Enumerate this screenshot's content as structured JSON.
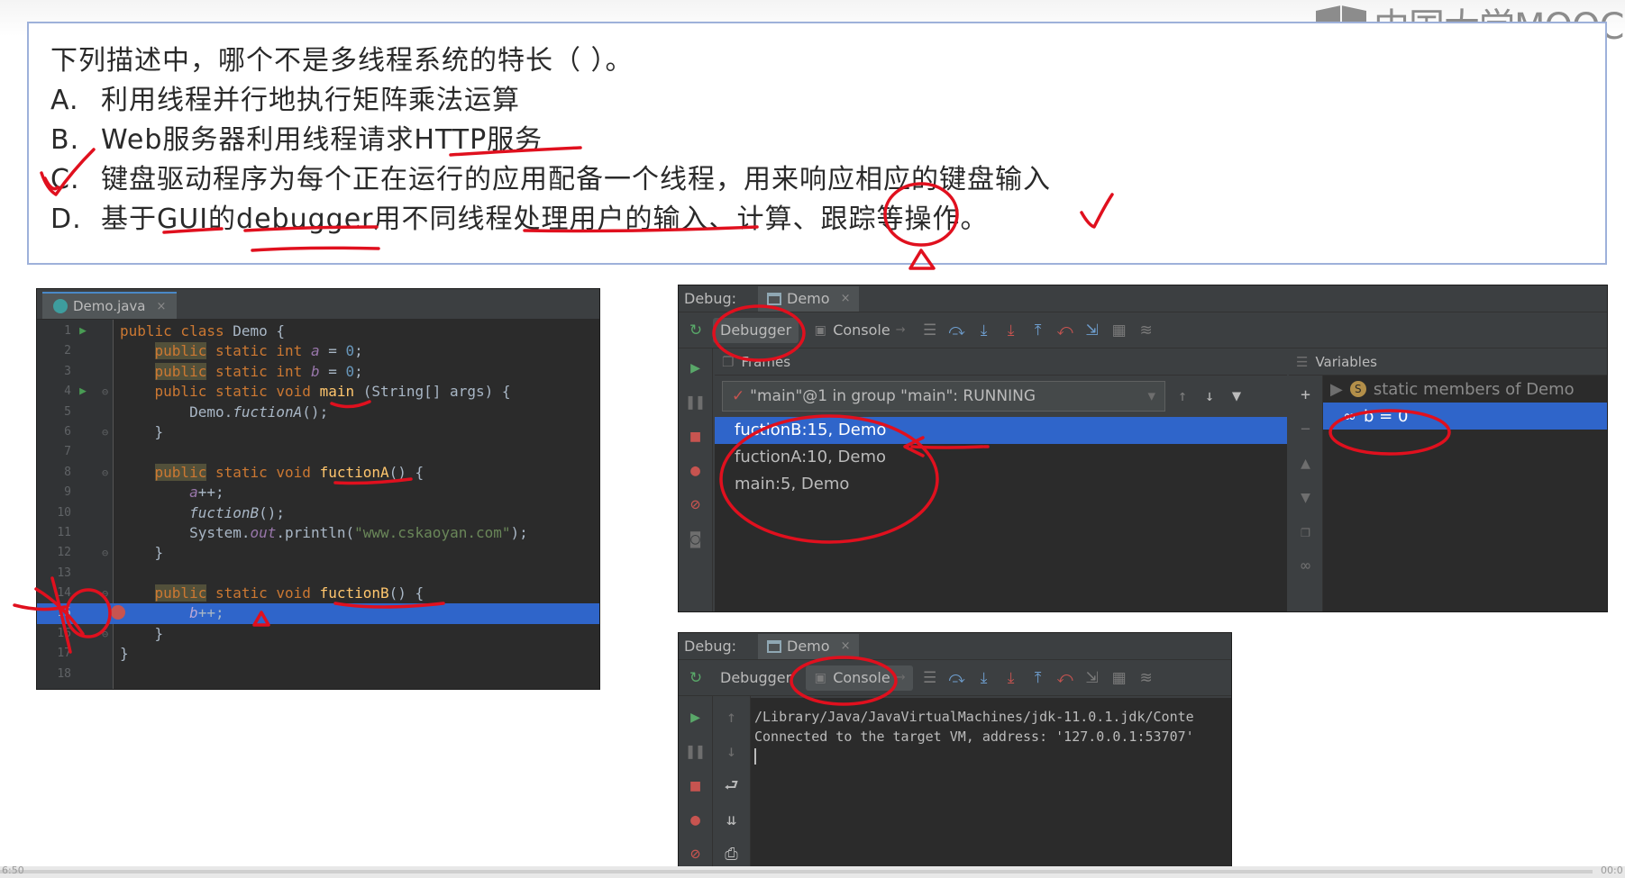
{
  "logo": {
    "text": "中国大学MOOC"
  },
  "question": {
    "stem": "下列描述中，哪个不是多线程系统的特长（    ）。",
    "options": [
      {
        "letter": "A.",
        "text": "利用线程并行地执行矩阵乘法运算"
      },
      {
        "letter": "B.",
        "text": "Web服务器利用线程请求HTTP服务"
      },
      {
        "letter": "C.",
        "text": "键盘驱动程序为每个正在运行的应用配备一个线程，用来响应相应的键盘输入"
      },
      {
        "letter": "D.",
        "text": "基于GUI的debugger用不同线程处理用户的输入、计算、跟踪等操作。"
      }
    ]
  },
  "editor": {
    "tab": "Demo.java",
    "lines": [
      "1",
      "2",
      "3",
      "4",
      "5",
      "6",
      "7",
      "8",
      "9",
      "10",
      "11",
      "12",
      "13",
      "14",
      "15",
      "16",
      "17",
      "18"
    ]
  },
  "debug_top": {
    "title": "Debug:",
    "run_tab": "Demo",
    "debugger_tab": "Debugger",
    "console_tab": "Console",
    "frames_label": "Frames",
    "variables_label": "Variables",
    "thread": "\"main\"@1 in group \"main\": RUNNING",
    "frames": [
      "fuctionB:15, Demo",
      "fuctionA:10, Demo",
      "main:5, Demo"
    ],
    "vars": {
      "static": "static members of Demo",
      "b": "b = 0"
    }
  },
  "debug_bottom": {
    "title": "Debug:",
    "run_tab": "Demo",
    "debugger_tab": "Debugger",
    "console_tab": "Console",
    "console_lines": [
      "/Library/Java/JavaVirtualMachines/jdk-11.0.1.jdk/Conte",
      "Connected to the target VM, address: '127.0.0.1:53707'"
    ]
  },
  "player": {
    "time_left": "6:50",
    "time_right": "00:0",
    "progress": 0.98
  }
}
